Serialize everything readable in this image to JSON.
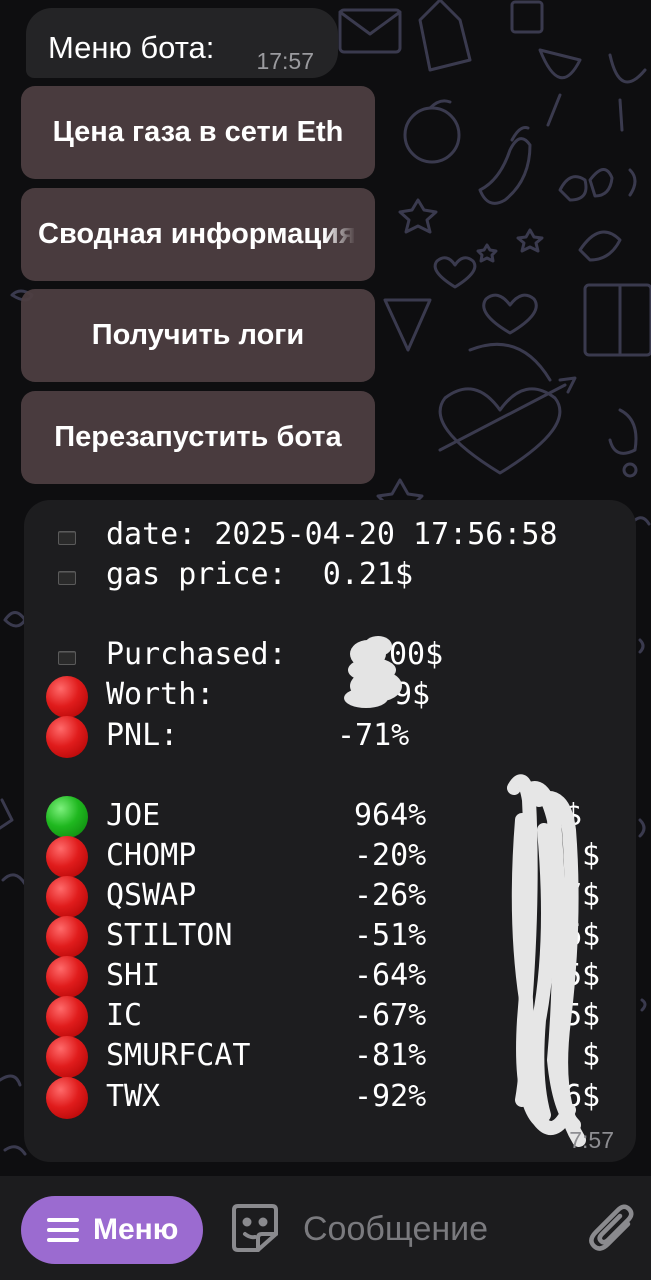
{
  "chat": {
    "menu_header": {
      "title": "Меню бота:",
      "time": "17:57"
    },
    "buttons": [
      {
        "label": "Цена газа в сети Eth",
        "icon": ""
      },
      {
        "label": "Сводная информация",
        "icon": ""
      },
      {
        "label": "Получить логи",
        "icon": ""
      },
      {
        "label": "Перезапустить бота",
        "icon": ""
      }
    ]
  },
  "report": {
    "date_line": "date: 2025-04-20 17:56:58",
    "gas_line": "gas price:  0.21$",
    "purchased_label": "Purchased:",
    "purchased_value": "00$",
    "worth_label": "Worth:",
    "worth_value": "9$",
    "pnl_label": "PNL:",
    "pnl_value": "-71%",
    "tokens": [
      {
        "name": "JOE",
        "pct": "964%",
        "value": "5$",
        "status": "green"
      },
      {
        "name": "CHOMP",
        "pct": "-20%",
        "value": "$",
        "status": "red"
      },
      {
        "name": "QSWAP",
        "pct": "-26%",
        "value": "7$",
        "status": "red"
      },
      {
        "name": "STILTON",
        "pct": "-51%",
        "value": "56$",
        "status": "red"
      },
      {
        "name": "SHI",
        "pct": "-64%",
        "value": "5$",
        "status": "red"
      },
      {
        "name": "IC",
        "pct": "-67%",
        "value": "5$",
        "status": "red"
      },
      {
        "name": "SMURFCAT",
        "pct": "-81%",
        "value": "$",
        "status": "red"
      },
      {
        "name": "TWX",
        "pct": "-92%",
        "value": "6$",
        "status": "red"
      }
    ],
    "time": "7:57",
    "colors": {
      "red": "#e01c1c",
      "green": "#1fb81f",
      "neutral": "#2a2a2a"
    }
  },
  "bottom": {
    "menu_label": "Меню",
    "message_placeholder": "Сообщение",
    "icons": {
      "menu": "hamburger-icon",
      "sticker": "sticker-icon",
      "attach": "paperclip-icon"
    },
    "accent": "#9b6bd0"
  }
}
